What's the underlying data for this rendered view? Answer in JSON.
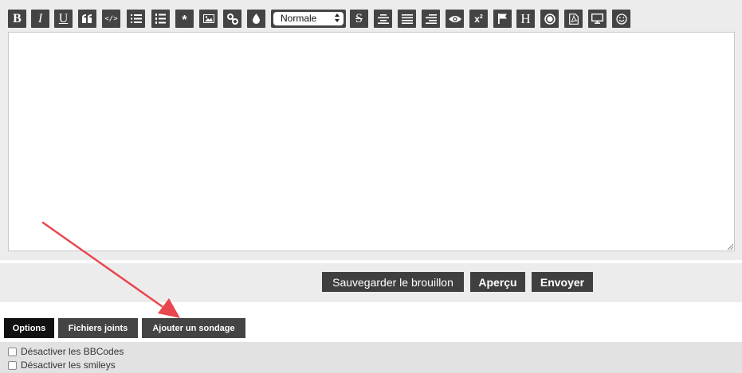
{
  "toolbar": {
    "buttons": [
      {
        "name": "bold-button",
        "icon": "bold-icon",
        "text": "B"
      },
      {
        "name": "italic-button",
        "icon": "italic-icon",
        "text": "I"
      },
      {
        "name": "underline-button",
        "icon": "underline-icon",
        "text": "U"
      },
      {
        "name": "quote-button",
        "icon": "quote-icon"
      },
      {
        "name": "code-button",
        "icon": "code-icon",
        "text": "</>"
      },
      {
        "name": "bullet-list-button",
        "icon": "bullet-list-icon"
      },
      {
        "name": "numbered-list-button",
        "icon": "numbered-list-icon"
      },
      {
        "name": "list-item-button",
        "icon": "asterisk-icon"
      },
      {
        "name": "image-button",
        "icon": "image-icon"
      },
      {
        "name": "link-button",
        "icon": "link-icon"
      },
      {
        "name": "color-button",
        "icon": "droplet-icon"
      },
      {
        "name": "strikethrough-button",
        "icon": "strikethrough-icon",
        "text": "S"
      },
      {
        "name": "align-center-button",
        "icon": "align-center-icon"
      },
      {
        "name": "align-justify-button",
        "icon": "align-justify-icon"
      },
      {
        "name": "align-right-button",
        "icon": "align-right-icon"
      },
      {
        "name": "spoiler-button",
        "icon": "eye-icon"
      },
      {
        "name": "superscript-button",
        "icon": "superscript-icon",
        "text": "x",
        "sup": "2"
      },
      {
        "name": "flag-button",
        "icon": "flag-icon"
      },
      {
        "name": "heading-button",
        "icon": "heading-icon",
        "text": "H"
      },
      {
        "name": "record-button",
        "icon": "record-icon"
      },
      {
        "name": "pdf-button",
        "icon": "pdf-icon"
      },
      {
        "name": "screen-button",
        "icon": "monitor-icon"
      },
      {
        "name": "emoji-button",
        "icon": "smiley-icon"
      }
    ],
    "font_size": {
      "selected": "Normale"
    }
  },
  "editor": {
    "value": ""
  },
  "actions": {
    "save_draft": "Sauvegarder le brouillon",
    "preview": "Aperçu",
    "submit": "Envoyer"
  },
  "tabs": [
    {
      "label": "Options",
      "active": true
    },
    {
      "label": "Fichiers joints",
      "active": false
    },
    {
      "label": "Ajouter un sondage",
      "active": false
    }
  ],
  "options": [
    {
      "label": "Désactiver les BBCodes",
      "checked": false
    },
    {
      "label": "Désactiver les smileys",
      "checked": false
    }
  ],
  "annotation": {
    "color": "#e8474d",
    "points_to": "Ajouter un sondage"
  },
  "colors": {
    "button_bg": "#444444",
    "active_tab": "#111111",
    "panel_bg": "#ececec"
  }
}
